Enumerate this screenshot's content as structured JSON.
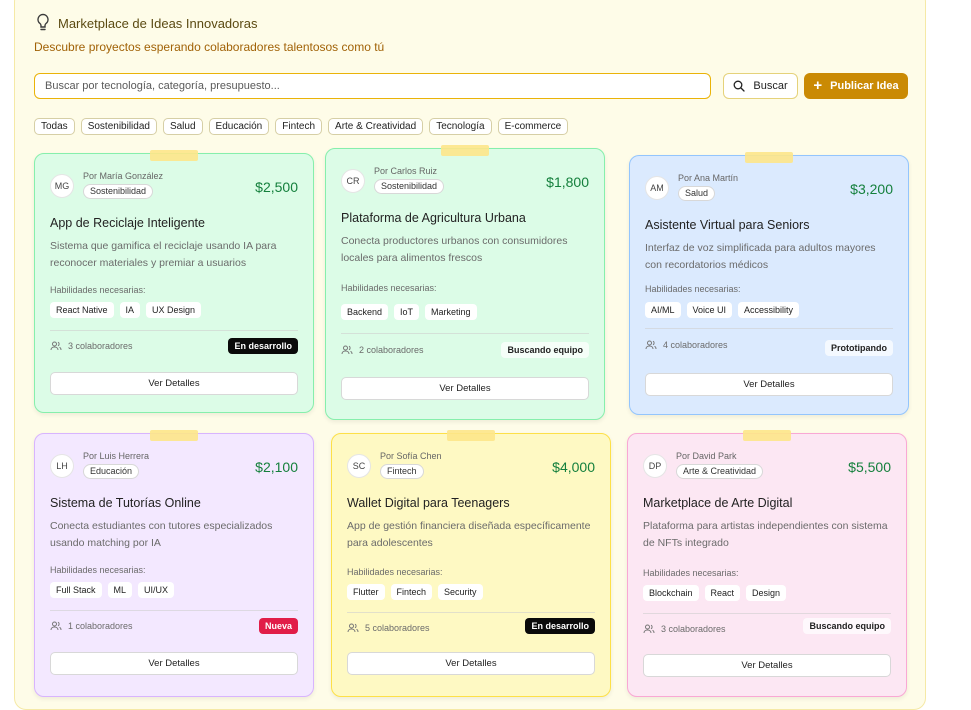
{
  "header": {
    "icon": "lightbulb-icon",
    "title": "Marketplace de Ideas Innovadoras",
    "subtitle": "Descubre proyectos esperando colaboradores talentosos como tú"
  },
  "search": {
    "placeholder": "Buscar por tecnología, categoría, presupuesto...",
    "button_label": "Buscar",
    "publish_label": "Publicar Idea"
  },
  "categories": [
    "Todas",
    "Sostenibilidad",
    "Salud",
    "Educación",
    "Fintech",
    "Arte & Creatividad",
    "Tecnología",
    "E-commerce"
  ],
  "skills_label": "Habilidades necesarias:",
  "details_label": "Ver Detalles",
  "colors": {
    "accent": "#ca8a04",
    "price": "#15803d",
    "green_card": "#dcfce7",
    "blue_card": "#dbeafe",
    "purple_card": "#f3e8ff",
    "yellow_card": "#fef9c3",
    "pink_card": "#fce7f3"
  },
  "cards": [
    {
      "initials": "MG",
      "author": "Por María González",
      "tag": "Sostenibilidad",
      "price": "$2,500",
      "title": "App de Reciclaje Inteligente",
      "description": "Sistema que gamifica el reciclaje usando IA para reconocer materiales y premiar a usuarios",
      "skills": [
        "React Native",
        "IA",
        "UX Design"
      ],
      "collaborators": "3 colaboradores",
      "status": "En desarrollo"
    },
    {
      "initials": "CR",
      "author": "Por Carlos Ruiz",
      "tag": "Sostenibilidad",
      "price": "$1,800",
      "title": "Plataforma de Agricultura Urbana",
      "description": "Conecta productores urbanos con consumidores locales para alimentos frescos",
      "skills": [
        "Backend",
        "IoT",
        "Marketing"
      ],
      "collaborators": "2 colaboradores",
      "status": "Buscando equipo"
    },
    {
      "initials": "AM",
      "author": "Por Ana Martín",
      "tag": "Salud",
      "price": "$3,200",
      "title": "Asistente Virtual para Seniors",
      "description": "Interfaz de voz simplificada para adultos mayores con recordatorios médicos",
      "skills": [
        "AI/ML",
        "Voice UI",
        "Accessibility"
      ],
      "collaborators": "4 colaboradores",
      "status": "Prototipando"
    },
    {
      "initials": "LH",
      "author": "Por Luis Herrera",
      "tag": "Educación",
      "price": "$2,100",
      "title": "Sistema de Tutorías Online",
      "description": "Conecta estudiantes con tutores especializados usando matching por IA",
      "skills": [
        "Full Stack",
        "ML",
        "UI/UX"
      ],
      "collaborators": "1 colaboradores",
      "status": "Nueva"
    },
    {
      "initials": "SC",
      "author": "Por Sofía Chen",
      "tag": "Fintech",
      "price": "$4,000",
      "title": "Wallet Digital para Teenagers",
      "description": "App de gestión financiera diseñada específicamente para adolescentes",
      "skills": [
        "Flutter",
        "Fintech",
        "Security"
      ],
      "collaborators": "5 colaboradores",
      "status": "En desarrollo"
    },
    {
      "initials": "DP",
      "author": "Por David Park",
      "tag": "Arte & Creatividad",
      "price": "$5,500",
      "title": "Marketplace de Arte Digital",
      "description": "Plataforma para artistas independientes con sistema de NFTs integrado",
      "skills": [
        "Blockchain",
        "React",
        "Design"
      ],
      "collaborators": "3 colaboradores",
      "status": "Buscando equipo"
    }
  ]
}
